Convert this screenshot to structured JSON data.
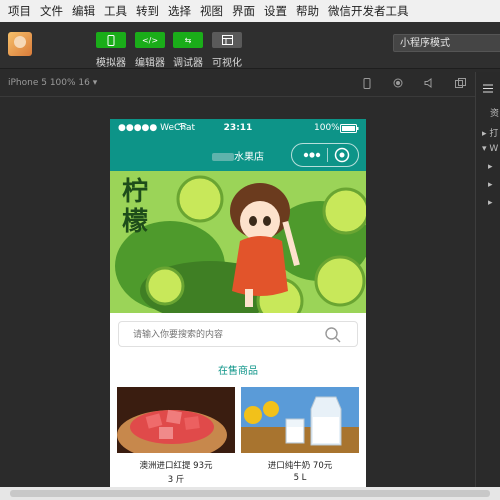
{
  "menu": [
    "项目",
    "文件",
    "编辑",
    "工具",
    "转到",
    "选择",
    "视图",
    "界面",
    "设置",
    "帮助",
    "微信开发者工具"
  ],
  "toolbar": {
    "buttons": [
      {
        "label": "模拟器",
        "icon": "phone-icon"
      },
      {
        "label": "编辑器",
        "icon": "code-icon"
      },
      {
        "label": "调试器",
        "icon": "debug-icon"
      },
      {
        "label": "可视化",
        "icon": "layout-icon"
      }
    ],
    "mode": "小程序模式"
  },
  "device": {
    "label": "iPhone 5 100% 16 ▾"
  },
  "phone": {
    "status": {
      "signal": "●●●●● WeChat",
      "time": "23:11",
      "battery": "100%"
    },
    "nav": {
      "title": "水果店"
    },
    "banner": {
      "text_big": "柠檬"
    },
    "search": {
      "placeholder": "请输入你要搜索的内容"
    },
    "section_title": "在售商品",
    "products": [
      {
        "name": "澳洲进口红提 93元",
        "unit": "3 斤"
      },
      {
        "name": "进口纯牛奶 70元",
        "unit": "5 L"
      }
    ]
  },
  "right_panel": {
    "items": [
      "资",
      "▸ 打",
      "▾ W",
      "▸",
      "▸",
      "▸"
    ]
  },
  "colors": {
    "accent": "#0d9488",
    "toolbar_green": "#1aad19"
  }
}
